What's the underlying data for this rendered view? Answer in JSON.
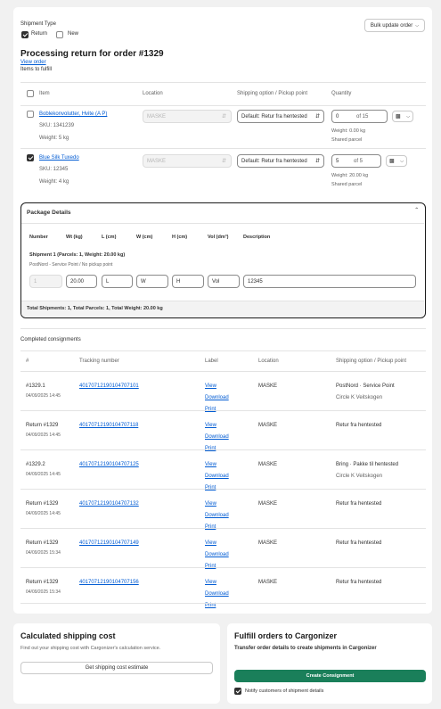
{
  "shipment_type": {
    "label": "Shipment Type",
    "options": [
      {
        "label": "Return",
        "checked": true
      },
      {
        "label": "New",
        "checked": false
      }
    ],
    "bulk_update_label": "Bulk update order"
  },
  "heading": {
    "title": "Processing return for order #1329",
    "view_order_link": "View order",
    "subtitle": "Items to fulfill"
  },
  "items_table": {
    "headers": [
      "Item",
      "Location",
      "Shipping option / Pickup point",
      "Quantity"
    ],
    "rows": [
      {
        "checked": false,
        "name": "Boblekonvolutter, Hvite (A P)",
        "sku": "SKU: 1341239",
        "weight": "Weight: 5 kg",
        "location": "MASKE",
        "shipping_option": "Default: Retur fra hentested",
        "qty_value": "0",
        "qty_of": "of 15",
        "qty_weight": "Weight: 0.00 kg",
        "qty_parcel": "Shared parcel"
      },
      {
        "checked": true,
        "name": "Blue Silk Tuxedo",
        "sku": "SKU: 12345",
        "weight": "Weight: 4 kg",
        "location": "MASKE",
        "shipping_option": "Default: Retur fra hentested",
        "qty_value": "5",
        "qty_of": "of 5",
        "qty_weight": "Weight: 20.00 kg",
        "qty_parcel": "Shared parcel"
      }
    ]
  },
  "package_details": {
    "title": "Package Details",
    "columns": [
      "Number",
      "Wt (kg)",
      "L (cm)",
      "W (cm)",
      "H (cm)",
      "Vol (dm³)",
      "Description"
    ],
    "shipment_title": "Shipment 1 (Parcels: 1, Weight: 20.00 kg)",
    "shipment_sub": "PostNord - Service Point / No pickup point",
    "inputs": {
      "number": "1",
      "weight": "20.00",
      "length_placeholder": "L",
      "width_placeholder": "W",
      "height_placeholder": "H",
      "vol_placeholder": "Vol",
      "description": "12345"
    },
    "totals": "Total Shipments: 1, Total Parcels: 1, Total Weight: 20.00 kg"
  },
  "consignments": {
    "title": "Completed consignments",
    "headers": [
      "#",
      "Tracking number",
      "Label",
      "Location",
      "Shipping option / Pickup point"
    ],
    "label_links": [
      "View",
      "Download",
      "Print"
    ],
    "rows": [
      {
        "id": "#1329.1",
        "date": "04/09/2025 14:45",
        "tracking": "40170712190104707101",
        "location": "MASKE",
        "shipping": "PostNord · Service Point",
        "pickup": "Circle K Veitskogen"
      },
      {
        "id": "Return #1329",
        "date": "04/09/2025 14:45",
        "tracking": "40170712190104707118",
        "location": "MASKE",
        "shipping": "Retur fra hentested",
        "pickup": ""
      },
      {
        "id": "#1329.2",
        "date": "04/09/2025 14:45",
        "tracking": "40170712190104707125",
        "location": "MASKE",
        "shipping": "Bring · Pakke til hentested",
        "pickup": "Circle K Veitskogen"
      },
      {
        "id": "Return #1329",
        "date": "04/09/2025 14:45",
        "tracking": "40170712190104707132",
        "location": "MASKE",
        "shipping": "Retur fra hentested",
        "pickup": ""
      },
      {
        "id": "Return #1329",
        "date": "04/09/2025 15:34",
        "tracking": "40170712190104707149",
        "location": "MASKE",
        "shipping": "Retur fra hentested",
        "pickup": ""
      },
      {
        "id": "Return #1329",
        "date": "04/09/2025 15:34",
        "tracking": "40170712190104707156",
        "location": "MASKE",
        "shipping": "Retur fra hentested",
        "pickup": ""
      }
    ]
  },
  "shipping_cost": {
    "title": "Calculated shipping cost",
    "desc": "Find out your shipping cost with Cargonizer's calculation service.",
    "button": "Get shipping cost estimate"
  },
  "fulfill": {
    "title": "Fulfill orders to Cargonizer",
    "desc": "Transfer order details to create shipments in Cargonizer",
    "button": "Create Consignment",
    "notify_label": "Notify customers of shipment details",
    "notify_checked": true
  },
  "colors": {
    "primary_green": "#1a7f5a",
    "link_blue": "#005bd3"
  }
}
